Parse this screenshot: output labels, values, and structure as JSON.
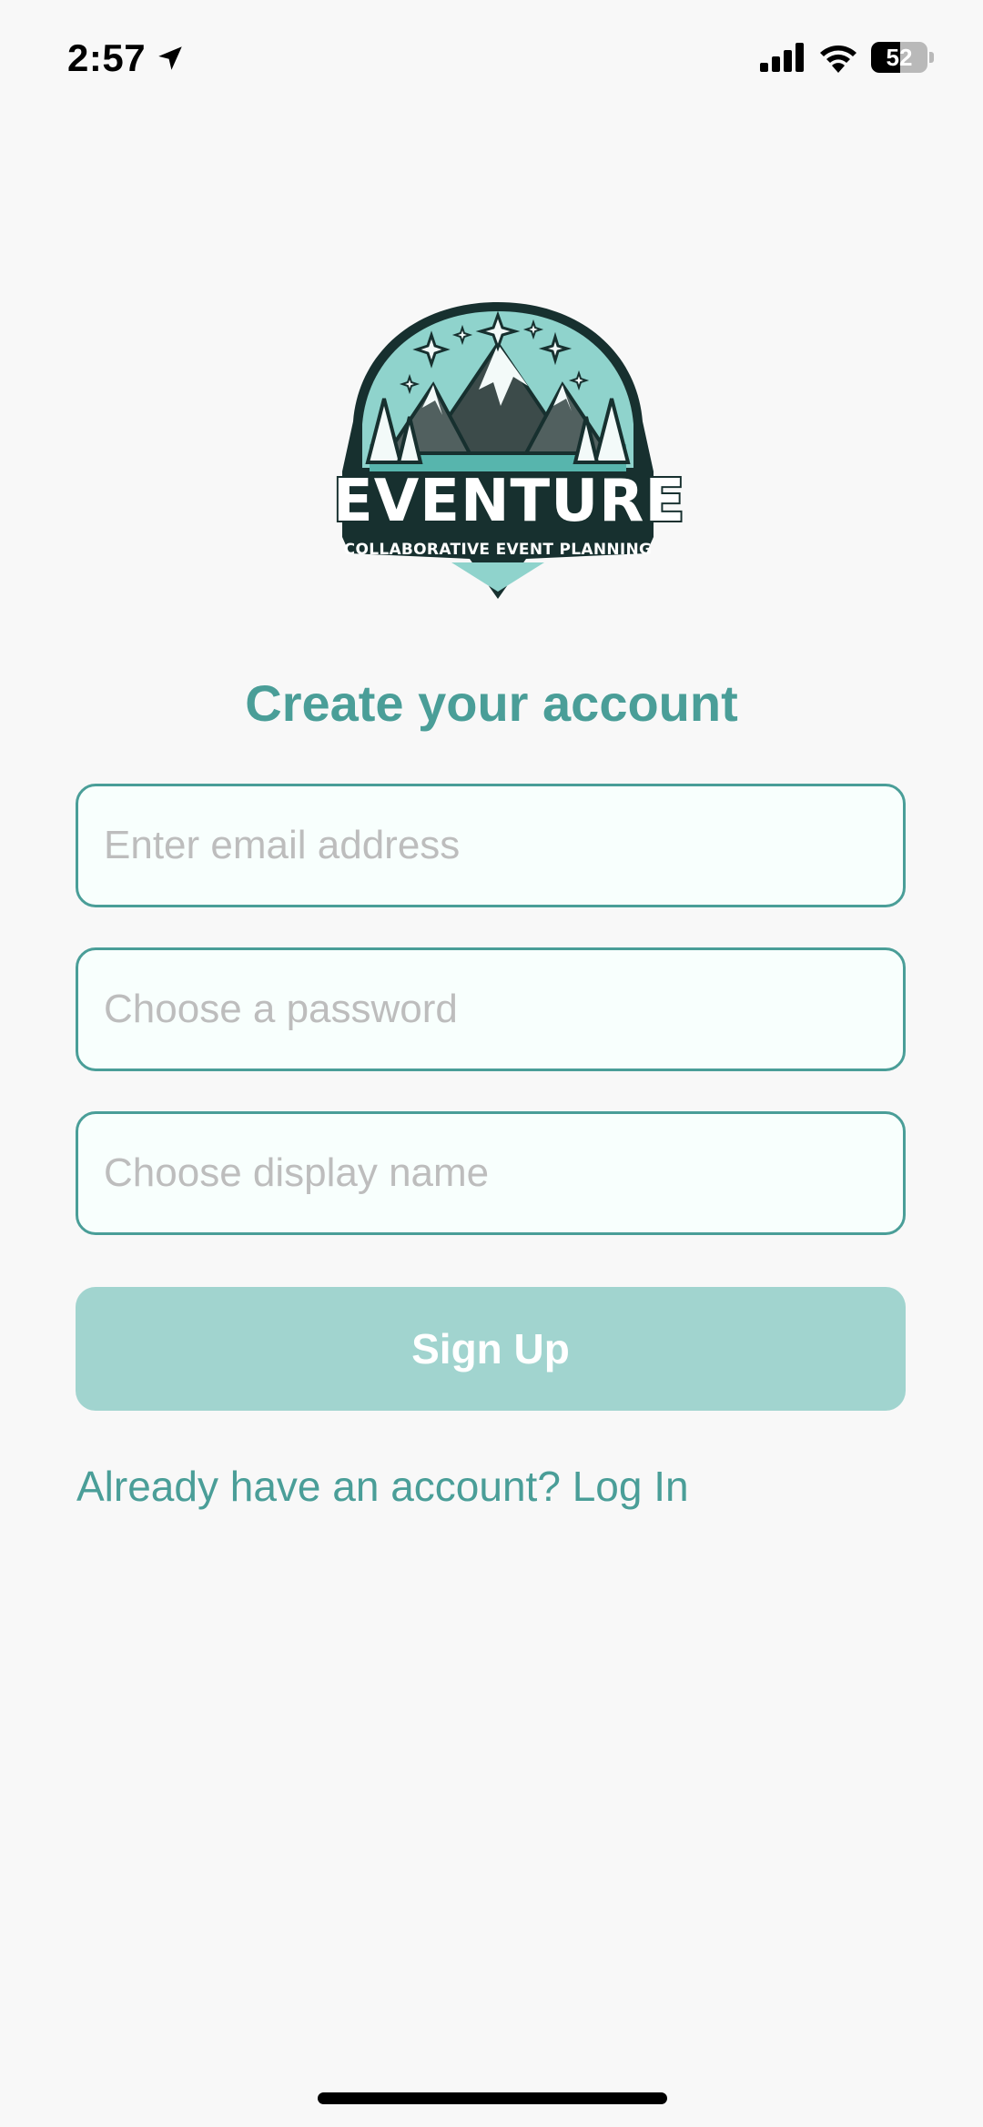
{
  "status_bar": {
    "time": "2:57",
    "battery_level": "52",
    "battery_fraction": 0.52,
    "icons": [
      "location-arrow-icon",
      "cellular-signal-icon",
      "wifi-icon",
      "battery-icon"
    ]
  },
  "logo": {
    "title": "EVENTURE",
    "subtitle": "COLLABORATIVE EVENT PLANNING"
  },
  "heading": "Create your account",
  "form": {
    "email_placeholder": "Enter email address",
    "password_placeholder": "Choose a password",
    "display_name_placeholder": "Choose display name",
    "signup_label": "Sign Up"
  },
  "login_link": "Already have an account? Log In",
  "colors": {
    "accent": "#4a9e98",
    "button_disabled": "#a1d4cf",
    "background": "#f8f8f8",
    "logo_teal": "#8fd3cc"
  }
}
